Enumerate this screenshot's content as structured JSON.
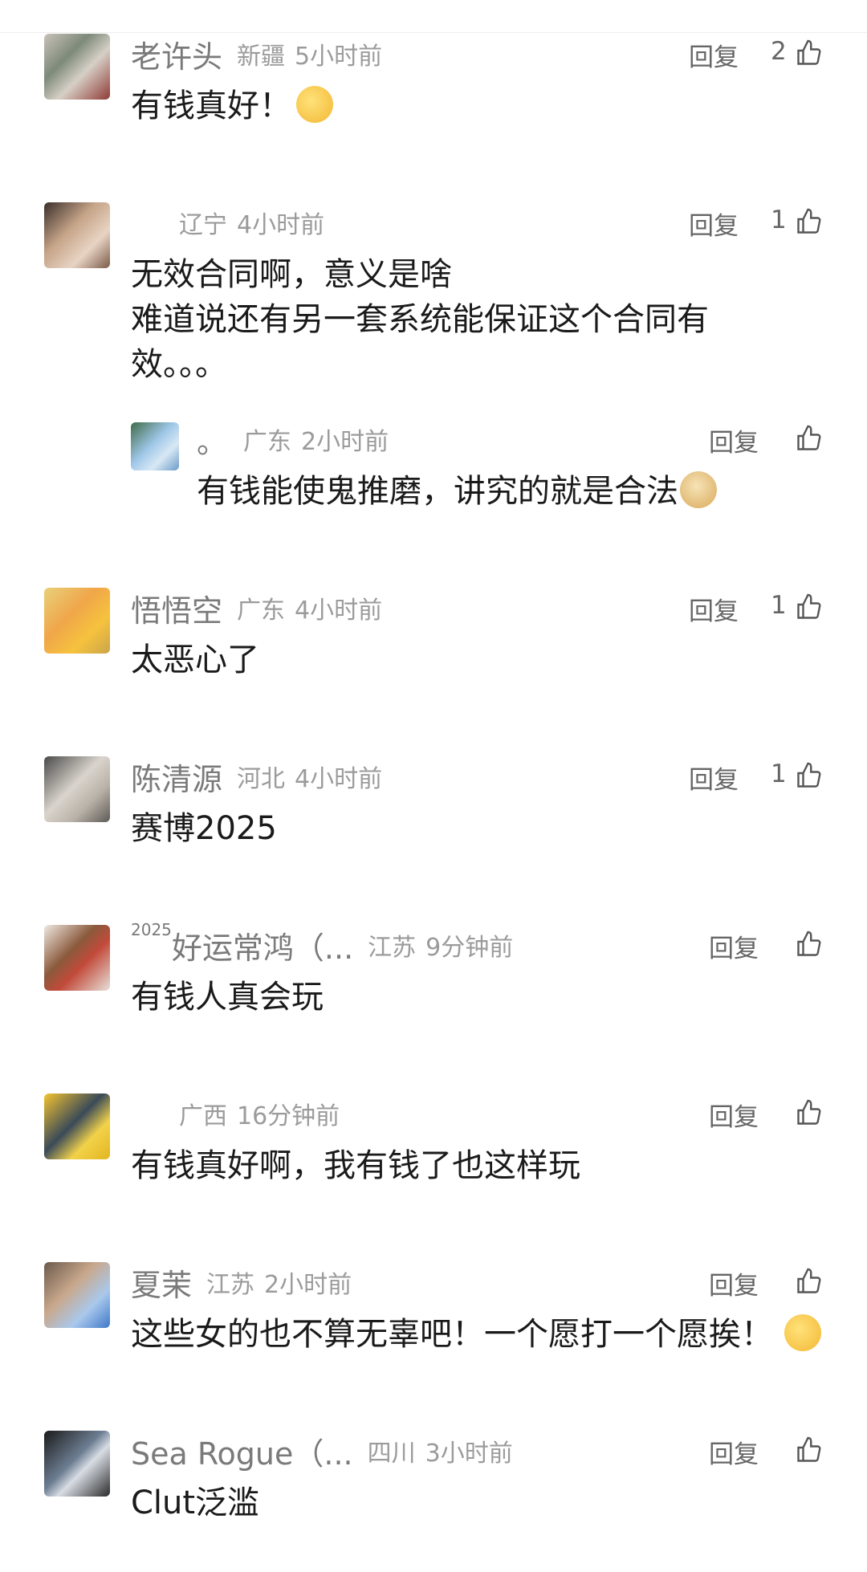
{
  "reply_label": "回复",
  "comments": [
    {
      "name": "老许头",
      "location": "新疆",
      "time": "5小时前",
      "text": "有钱真好！",
      "likes": "2",
      "emoji": "thinking-face"
    },
    {
      "name": "",
      "location": "辽宁",
      "time": "4小时前",
      "text_lines": [
        "无效合同啊，意义是啥",
        "难道说还有另一套系统能保证这个合同有",
        "效。。。"
      ],
      "likes": "1"
    },
    {
      "name": "。",
      "location": "广东",
      "time": "2小时前",
      "text": "有钱能使鬼推磨，讲究的就是合法",
      "likes": "",
      "emoji": "doge-face"
    },
    {
      "name": "悟悟空",
      "location": "广东",
      "time": "4小时前",
      "text": "太恶心了",
      "likes": "1"
    },
    {
      "name": "陈清源",
      "location": "河北",
      "time": "4小时前",
      "text": "赛博2025",
      "likes": "1"
    },
    {
      "name_sup": "2025",
      "name": "好运常鸿（...",
      "location": "江苏",
      "time": "9分钟前",
      "text": "有钱人真会玩",
      "likes": ""
    },
    {
      "name": "",
      "location": "广西",
      "time": "16分钟前",
      "text": "有钱真好啊，我有钱了也这样玩",
      "likes": ""
    },
    {
      "name": "夏茉",
      "location": "江苏",
      "time": "2小时前",
      "text": "这些女的也不算无辜吧！一个愿打一个愿挨！",
      "likes": "",
      "emoji": "kissing-face"
    },
    {
      "name": "Sea Rogue（...",
      "location": "四川",
      "time": "3小时前",
      "text": "Clut泛滥",
      "likes": ""
    }
  ]
}
